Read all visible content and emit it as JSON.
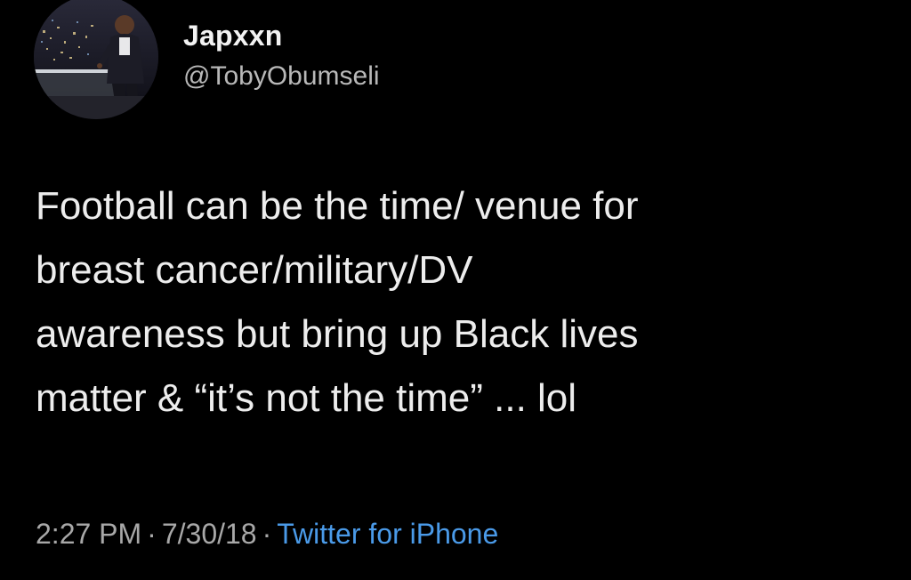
{
  "user": {
    "display_name": "Japxxn",
    "handle": "@TobyObumseli"
  },
  "tweet": {
    "text": "Football can be the time/ venue for\nbreast cancer/military/DV\nawareness but bring up Black lives\nmatter & “it’s not the time” ... lol",
    "time": "2:27 PM",
    "date": "7/30/18",
    "separator": "·",
    "source": "Twitter for iPhone"
  },
  "colors": {
    "background": "#000000",
    "text": "#ededed",
    "muted": "#a8a8a8",
    "link": "#4a9ae8"
  }
}
